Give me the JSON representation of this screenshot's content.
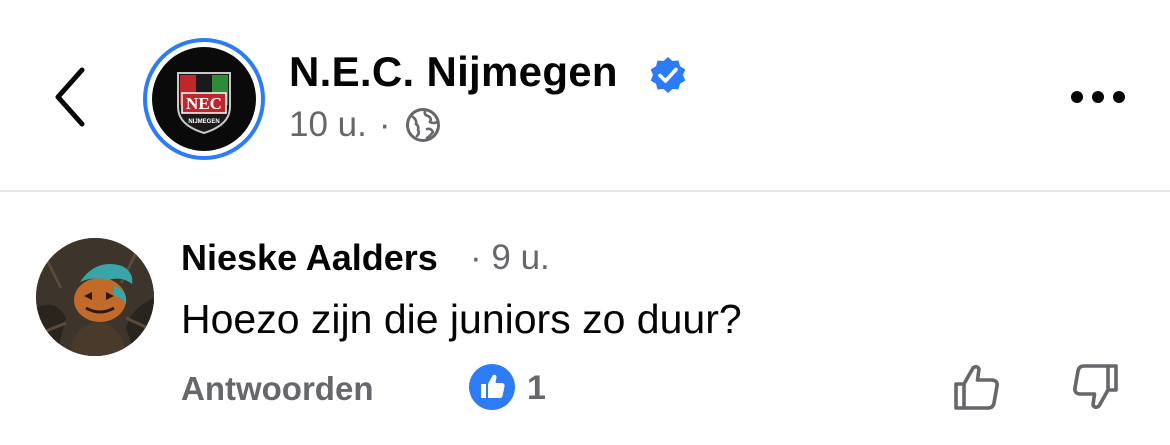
{
  "post": {
    "page_name": "N.E.C. Nijmegen",
    "time": "10 u.",
    "separator": "·",
    "logo_text": "NEC",
    "logo_subtext": "NIJMEGEN",
    "icons": {
      "back": "chevron-left-icon",
      "verified": "verified-badge-icon",
      "audience": "globe-icon",
      "more": "more-options-icon"
    }
  },
  "comment": {
    "author": "Nieske Aalders",
    "time": "· 9 u.",
    "text": "Hoezo zijn die juniors zo duur?",
    "reply_label": "Antwoorden",
    "like_count": "1"
  },
  "colors": {
    "accent": "#2d7cf6",
    "like_badge": "#2d7cf6",
    "secondary_text": "#65676b",
    "divider": "#e4e6eb"
  }
}
